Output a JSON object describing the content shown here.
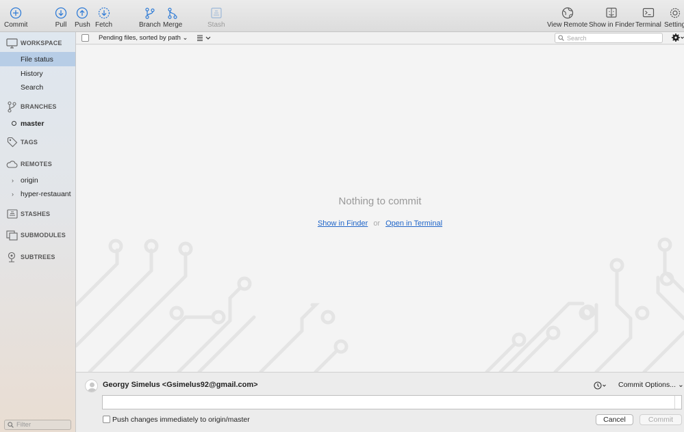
{
  "toolbar": {
    "commit": "Commit",
    "pull": "Pull",
    "push": "Push",
    "fetch": "Fetch",
    "branch": "Branch",
    "merge": "Merge",
    "stash": "Stash",
    "view_remote": "View Remote",
    "show_in_finder": "Show in Finder",
    "terminal": "Terminal",
    "settings": "Setting"
  },
  "sidebar": {
    "workspace": {
      "title": "WORKSPACE",
      "items": [
        "File status",
        "History",
        "Search"
      ],
      "selected": "File status"
    },
    "branches": {
      "title": "BRANCHES",
      "items": [
        "master"
      ]
    },
    "tags": {
      "title": "TAGS"
    },
    "remotes": {
      "title": "REMOTES",
      "items": [
        "origin",
        "hyper-restauant"
      ]
    },
    "stashes": {
      "title": "STASHES"
    },
    "submodules": {
      "title": "SUBMODULES"
    },
    "subtrees": {
      "title": "SUBTREES"
    },
    "filter_placeholder": "Filter"
  },
  "filterbar": {
    "sort_label": "Pending files, sorted by path",
    "search_placeholder": "Search"
  },
  "main": {
    "empty_message": "Nothing to commit",
    "show_in_finder": "Show in Finder",
    "or": "or",
    "open_in_terminal": "Open in Terminal"
  },
  "commit_panel": {
    "author": "Georgy Simelus <Gsimelus92@gmail.com>",
    "commit_options": "Commit Options...",
    "push_label": "Push changes immediately to origin/master",
    "push_checked": false,
    "cancel": "Cancel",
    "commit": "Commit"
  },
  "colors": {
    "accent_blue": "#2f7bd6",
    "selection": "#b7cde6",
    "link": "#1e64c8"
  }
}
